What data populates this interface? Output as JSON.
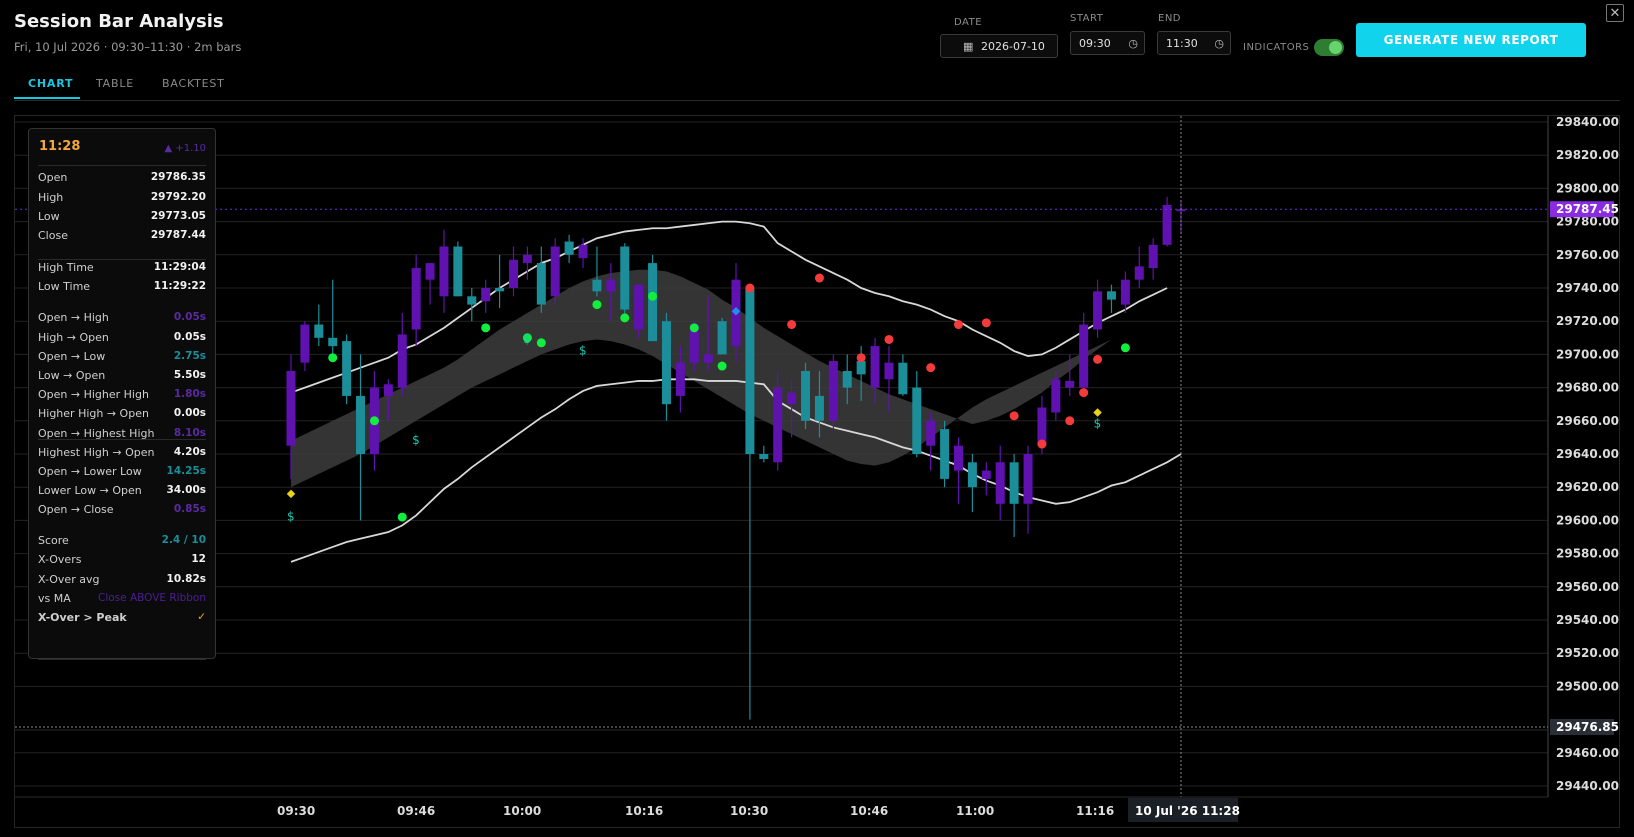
{
  "app": {
    "title": "Session Bar Analysis",
    "subtitle": "Fri, 10 Jul 2026 · 09:30–11:30 · 2m bars",
    "close_glyph": "✕"
  },
  "controls": {
    "date_label": "DATE",
    "date_value": "2026-07-10",
    "start_label": "START",
    "start_value": "09:30",
    "end_label": "END",
    "end_value": "11:30",
    "indicators_label": "INDICATORS",
    "indicators_on": true,
    "generate_label": "GENERATE NEW REPORT",
    "calendar_icon": "calendar-icon",
    "clock_icon": "clock-icon"
  },
  "tabs": [
    {
      "label": "CHART",
      "active": true
    },
    {
      "label": "TABLE",
      "active": false
    },
    {
      "label": "BACKTEST",
      "active": false
    }
  ],
  "info": {
    "time": "11:28",
    "change": "▲ +1.10",
    "rows": [
      {
        "k": "Open",
        "v": "29786.35"
      },
      {
        "k": "High",
        "v": "29792.20"
      },
      {
        "k": "Low",
        "v": "29773.05"
      },
      {
        "k": "Close",
        "v": "29787.44"
      },
      {
        "k": "High Time",
        "v": "11:29:04"
      },
      {
        "k": "Low Time",
        "v": "11:29:22"
      },
      {
        "k": "Open → High",
        "v": "0.05s"
      },
      {
        "k": "High → Open",
        "v": "0.05s"
      },
      {
        "k": "Open → Low",
        "v": "2.75s"
      },
      {
        "k": "Low → Open",
        "v": "5.50s"
      },
      {
        "k": "Open → Higher High",
        "v": "1.80s"
      },
      {
        "k": "Higher High → Open",
        "v": "0.00s"
      },
      {
        "k": "Open → Highest High",
        "v": "8.10s"
      },
      {
        "k": "Highest High → Open",
        "v": "4.20s"
      },
      {
        "k": "Open → Lower Low",
        "v": "14.25s"
      },
      {
        "k": "Lower Low → Open",
        "v": "34.00s"
      },
      {
        "k": "Open → Close",
        "v": "0.85s"
      },
      {
        "k": "Score",
        "v": "2.4 / 10"
      },
      {
        "k": "X-Overs",
        "v": "12"
      },
      {
        "k": "X-Over avg",
        "v": "10.82s"
      },
      {
        "k": "vs MA",
        "v": "Close ABOVE Ribbon"
      },
      {
        "k": "X-Over > Peak",
        "v": "✓"
      }
    ]
  },
  "chart_data": {
    "type": "candlestick",
    "y_ticks": [
      "29840.00",
      "29820.00",
      "29800.00",
      "29780.00",
      "29760.00",
      "29740.00",
      "29720.00",
      "29700.00",
      "29680.00",
      "29660.00",
      "29640.00",
      "29620.00",
      "29600.00",
      "29580.00",
      "29560.00",
      "29540.00",
      "29520.00",
      "29500.00",
      "29460.00",
      "29440.00"
    ],
    "x_ticks": [
      "09:30",
      "09:46",
      "10:00",
      "10:16",
      "10:30",
      "10:46",
      "11:00",
      "11:16"
    ],
    "last_price_label": "29787.45",
    "lower_price_label": "29476.85",
    "crosshair_label": "10 Jul '26   11:28",
    "ylim": [
      29440,
      29840
    ],
    "colors": {
      "up": "#6012b0",
      "down": "#1b8e9a",
      "bullet_green": "#11ee3e",
      "bullet_red": "#f43b3b",
      "band": "#d8d8d8",
      "ribbon": "#3d3d3d",
      "accent": "#19c7e0"
    },
    "candles": [
      {
        "o": 29645,
        "h": 29700,
        "l": 29625,
        "c": 29690
      },
      {
        "o": 29695,
        "h": 29720,
        "l": 29690,
        "c": 29718
      },
      {
        "o": 29718,
        "h": 29730,
        "l": 29705,
        "c": 29710
      },
      {
        "o": 29710,
        "h": 29745,
        "l": 29700,
        "c": 29705
      },
      {
        "o": 29708,
        "h": 29712,
        "l": 29670,
        "c": 29675
      },
      {
        "o": 29675,
        "h": 29700,
        "l": 29600,
        "c": 29640
      },
      {
        "o": 29640,
        "h": 29690,
        "l": 29630,
        "c": 29680
      },
      {
        "o": 29675,
        "h": 29685,
        "l": 29660,
        "c": 29682
      },
      {
        "o": 29680,
        "h": 29725,
        "l": 29675,
        "c": 29712
      },
      {
        "o": 29715,
        "h": 29760,
        "l": 29705,
        "c": 29752
      },
      {
        "o": 29745,
        "h": 29755,
        "l": 29730,
        "c": 29755
      },
      {
        "o": 29735,
        "h": 29775,
        "l": 29725,
        "c": 29765
      },
      {
        "o": 29765,
        "h": 29768,
        "l": 29735,
        "c": 29735
      },
      {
        "o": 29735,
        "h": 29740,
        "l": 29720,
        "c": 29730
      },
      {
        "o": 29732,
        "h": 29745,
        "l": 29725,
        "c": 29740
      },
      {
        "o": 29740,
        "h": 29760,
        "l": 29728,
        "c": 29738
      },
      {
        "o": 29740,
        "h": 29765,
        "l": 29735,
        "c": 29757
      },
      {
        "o": 29755,
        "h": 29765,
        "l": 29745,
        "c": 29760
      },
      {
        "o": 29755,
        "h": 29765,
        "l": 29725,
        "c": 29730
      },
      {
        "o": 29735,
        "h": 29770,
        "l": 29730,
        "c": 29765
      },
      {
        "o": 29768,
        "h": 29772,
        "l": 29755,
        "c": 29760
      },
      {
        "o": 29758,
        "h": 29770,
        "l": 29752,
        "c": 29766
      },
      {
        "o": 29745,
        "h": 29765,
        "l": 29735,
        "c": 29738
      },
      {
        "o": 29738,
        "h": 29755,
        "l": 29720,
        "c": 29745
      },
      {
        "o": 29765,
        "h": 29767,
        "l": 29722,
        "c": 29727
      },
      {
        "o": 29715,
        "h": 29740,
        "l": 29710,
        "c": 29742
      },
      {
        "o": 29755,
        "h": 29760,
        "l": 29708,
        "c": 29708
      },
      {
        "o": 29720,
        "h": 29725,
        "l": 29660,
        "c": 29670
      },
      {
        "o": 29675,
        "h": 29705,
        "l": 29665,
        "c": 29695
      },
      {
        "o": 29695,
        "h": 29720,
        "l": 29690,
        "c": 29718
      },
      {
        "o": 29695,
        "h": 29735,
        "l": 29690,
        "c": 29700
      },
      {
        "o": 29720,
        "h": 29722,
        "l": 29700,
        "c": 29700
      },
      {
        "o": 29705,
        "h": 29755,
        "l": 29695,
        "c": 29745
      },
      {
        "o": 29740,
        "h": 29742,
        "l": 29480,
        "c": 29640
      },
      {
        "o": 29640,
        "h": 29645,
        "l": 29635,
        "c": 29637
      },
      {
        "o": 29635,
        "h": 29690,
        "l": 29630,
        "c": 29680
      },
      {
        "o": 29670,
        "h": 29685,
        "l": 29650,
        "c": 29677
      },
      {
        "o": 29690,
        "h": 29695,
        "l": 29655,
        "c": 29660
      },
      {
        "o": 29675,
        "h": 29690,
        "l": 29650,
        "c": 29660
      },
      {
        "o": 29660,
        "h": 29700,
        "l": 29655,
        "c": 29696
      },
      {
        "o": 29690,
        "h": 29700,
        "l": 29670,
        "c": 29680
      },
      {
        "o": 29696,
        "h": 29705,
        "l": 29672,
        "c": 29688
      },
      {
        "o": 29680,
        "h": 29710,
        "l": 29670,
        "c": 29705
      },
      {
        "o": 29685,
        "h": 29705,
        "l": 29665,
        "c": 29695
      },
      {
        "o": 29695,
        "h": 29700,
        "l": 29675,
        "c": 29676
      },
      {
        "o": 29680,
        "h": 29690,
        "l": 29638,
        "c": 29640
      },
      {
        "o": 29645,
        "h": 29665,
        "l": 29630,
        "c": 29660
      },
      {
        "o": 29655,
        "h": 29660,
        "l": 29620,
        "c": 29625
      },
      {
        "o": 29630,
        "h": 29650,
        "l": 29610,
        "c": 29645
      },
      {
        "o": 29635,
        "h": 29640,
        "l": 29605,
        "c": 29620
      },
      {
        "o": 29625,
        "h": 29635,
        "l": 29615,
        "c": 29630
      },
      {
        "o": 29610,
        "h": 29645,
        "l": 29600,
        "c": 29635
      },
      {
        "o": 29635,
        "h": 29640,
        "l": 29590,
        "c": 29610
      },
      {
        "o": 29610,
        "h": 29645,
        "l": 29592,
        "c": 29640
      },
      {
        "o": 29645,
        "h": 29675,
        "l": 29640,
        "c": 29668
      },
      {
        "o": 29665,
        "h": 29690,
        "l": 29660,
        "c": 29685
      },
      {
        "o": 29680,
        "h": 29700,
        "l": 29675,
        "c": 29684
      },
      {
        "o": 29680,
        "h": 29725,
        "l": 29678,
        "c": 29718
      },
      {
        "o": 29715,
        "h": 29745,
        "l": 29710,
        "c": 29738
      },
      {
        "o": 29738,
        "h": 29742,
        "l": 29725,
        "c": 29733
      },
      {
        "o": 29730,
        "h": 29750,
        "l": 29725,
        "c": 29745
      },
      {
        "o": 29745,
        "h": 29765,
        "l": 29740,
        "c": 29753
      },
      {
        "o": 29752,
        "h": 29770,
        "l": 29745,
        "c": 29766
      },
      {
        "o": 29766,
        "h": 29795,
        "l": 29765,
        "c": 29790
      },
      {
        "o": 29786.35,
        "h": 29792.2,
        "l": 29773.05,
        "c": 29787.44
      }
    ],
    "upper_band": [
      29677,
      29680,
      29683,
      29686,
      29689,
      29692,
      29695,
      29698,
      29703,
      29706,
      29711,
      29716,
      29722,
      29728,
      29734,
      29740,
      29745,
      29750,
      29755,
      29758,
      29762,
      29766,
      29770,
      29772,
      29774,
      29775,
      29776,
      29776,
      29777,
      29778,
      29779,
      29780,
      29780,
      29779,
      29777,
      29767,
      29762,
      29757,
      29753,
      29749,
      29745,
      29740,
      29737,
      29735,
      29732,
      29730,
      29727,
      29723,
      29720,
      29715,
      29711,
      29707,
      29702,
      29699,
      29700,
      29704,
      29709,
      29714,
      29719,
      29723,
      29727,
      29732,
      29736,
      29740
    ],
    "lower_band": [
      29575,
      29578,
      29581,
      29584,
      29587,
      29589,
      29591,
      29593,
      29597,
      29603,
      29611,
      29619,
      29625,
      29632,
      29638,
      29644,
      29650,
      29656,
      29662,
      29667,
      29673,
      29678,
      29681,
      29682,
      29683,
      29684,
      29684,
      29685,
      29685,
      29685,
      29684,
      29684,
      29684,
      29683,
      29682,
      29672,
      29667,
      29662,
      29659,
      29656,
      29654,
      29652,
      29650,
      29647,
      29644,
      29642,
      29639,
      29636,
      29633,
      29628,
      29624,
      29621,
      29617,
      29614,
      29612,
      29610,
      29611,
      29614,
      29617,
      29621,
      29623,
      29627,
      29631,
      29635,
      29640
    ],
    "ribbon_top": [
      29648,
      29652,
      29656,
      29660,
      29664,
      29668,
      29672,
      29676,
      29680,
      29684,
      29688,
      29692,
      29697,
      29703,
      29709,
      29715,
      29720,
      29725,
      29730,
      29735,
      29740,
      29744,
      29747,
      29749,
      29750,
      29751,
      29751,
      29750,
      29747,
      29743,
      29739,
      29733,
      29728,
      29722,
      29716,
      29711,
      29706,
      29701,
      29696,
      29692,
      29688,
      29684,
      29680,
      29676,
      29673,
      29670,
      29667,
      29664,
      29661,
      29658,
      29660,
      29663,
      29667,
      29672,
      29677,
      29684,
      29690,
      29697,
      29703,
      29709
    ],
    "ribbon_bot": [
      29620,
      29624,
      29628,
      29632,
      29636,
      29640,
      29645,
      29650,
      29655,
      29660,
      29665,
      29670,
      29675,
      29680,
      29684,
      29688,
      29692,
      29696,
      29700,
      29703,
      29706,
      29708,
      29709,
      29708,
      29706,
      29703,
      29699,
      29694,
      29689,
      29684,
      29679,
      29674,
      29669,
      29664,
      29660,
      29656,
      29652,
      29648,
      29644,
      29640,
      29636,
      29634,
      29633,
      29635,
      29639,
      29644,
      29650,
      29656,
      29662,
      29668,
      29673
    ]
  }
}
